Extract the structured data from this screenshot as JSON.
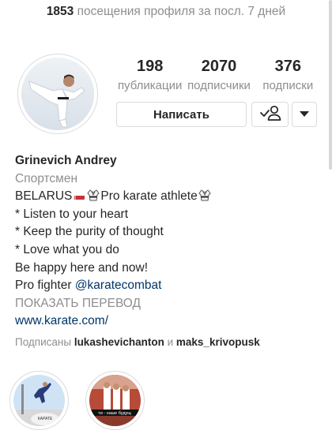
{
  "visits": {
    "count": "1853",
    "text": "посещения профиля за посл. 7 дней"
  },
  "stats": [
    {
      "value": "198",
      "label": "публикации"
    },
    {
      "value": "2070",
      "label": "подписчики"
    },
    {
      "value": "376",
      "label": "подписки"
    }
  ],
  "actions": {
    "message_label": "Написать",
    "following_icon": "user-check-icon",
    "more_icon": "chevron-down-icon"
  },
  "bio": {
    "name": "Grinevich Andrey",
    "category": "Спортсмен",
    "line1_a": "BELARUS",
    "line1_b": "Pro karate athlete",
    "line2": "* Listen to your heart",
    "line3": "* Keep the purity of thought",
    "line4": "* Love what you do",
    "line5": "Be happy here and now!",
    "line6_a": "Pro fighter ",
    "mention": "@karatecombat",
    "translate": "ПОКАЗАТЬ ПЕРЕВОД",
    "link": "www.karate.com/",
    "followed_prefix": "Подписаны ",
    "followed_user1": "lukashevichanton",
    "followed_and": " и ",
    "followed_user2": "maks_krivopusk"
  },
  "highlights": [
    {
      "caption_text": "КАРАТЕ"
    },
    {
      "caption_text": "ти - наше будущ"
    }
  ],
  "colors": {
    "accent_link": "#003569",
    "secondary_text": "#8e8e8e",
    "border": "#dbdbdb"
  }
}
